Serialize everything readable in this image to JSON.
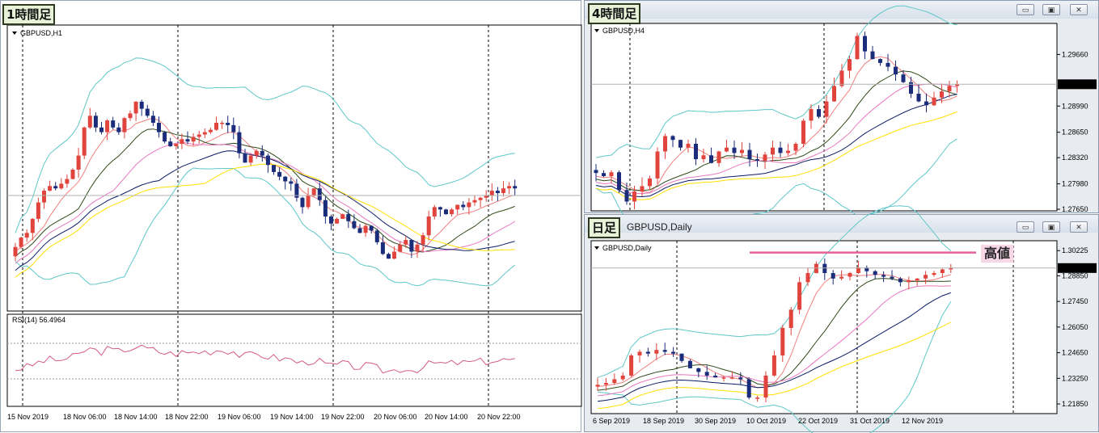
{
  "panels": {
    "h1": {
      "badge": "1時間足",
      "title": "GBPUSD,H1"
    },
    "h4": {
      "badge": "4時間足",
      "title": "GBPUSD,H4"
    },
    "daily": {
      "badge": "日足",
      "window_title": "GBPUSD,Daily",
      "title": "GBPUSD,Daily",
      "high_label": "高値"
    }
  },
  "window_buttons": {
    "minimize": "▭",
    "restore": "▣",
    "close": "✕"
  },
  "chart_data": [
    {
      "id": "h1",
      "type": "candlestick",
      "title": "GBPUSD,H1",
      "x_labels": [
        "15 Nov 2019",
        "18 Nov 06:00",
        "18 Nov 14:00",
        "18 Nov 22:00",
        "19 Nov 06:00",
        "19 Nov 14:00",
        "19 Nov 22:00",
        "20 Nov 06:00",
        "20 Nov 14:00",
        "20 Nov 22:00"
      ],
      "indicator": {
        "name": "RSI(14)",
        "value": "56.4964"
      },
      "indicators_drawn": [
        "Bollinger Bands",
        "moving averages (red, dark green, pink, navy, yellow)"
      ],
      "ylim": [
        0,
        1
      ],
      "closes": [
        0.17,
        0.21,
        0.23,
        0.29,
        0.36,
        0.41,
        0.43,
        0.42,
        0.44,
        0.46,
        0.5,
        0.56,
        0.68,
        0.73,
        0.68,
        0.66,
        0.71,
        0.68,
        0.66,
        0.72,
        0.74,
        0.79,
        0.76,
        0.73,
        0.7,
        0.66,
        0.62,
        0.6,
        0.61,
        0.63,
        0.62,
        0.64,
        0.65,
        0.66,
        0.67,
        0.7,
        0.7,
        0.69,
        0.66,
        0.57,
        0.53,
        0.56,
        0.58,
        0.56,
        0.52,
        0.49,
        0.47,
        0.45,
        0.44,
        0.38,
        0.34,
        0.39,
        0.42,
        0.37,
        0.3,
        0.27,
        0.29,
        0.31,
        0.28,
        0.25,
        0.23,
        0.26,
        0.24,
        0.19,
        0.14,
        0.12,
        0.15,
        0.18,
        0.2,
        0.15,
        0.18,
        0.22,
        0.3,
        0.34,
        0.33,
        0.31,
        0.33,
        0.35,
        0.34,
        0.36,
        0.37,
        0.38,
        0.39,
        0.41,
        0.4,
        0.42,
        0.43,
        0.42
      ]
    },
    {
      "id": "h4",
      "type": "candlestick",
      "title": "GBPUSD,H4",
      "y_ticks": [
        "1.29660",
        "1.28990",
        "1.28650",
        "1.28320",
        "1.27980",
        "1.27650"
      ],
      "current_price": "1.29273",
      "closes": [
        1.2812,
        1.2808,
        1.2813,
        1.279,
        1.2775,
        1.2788,
        1.2795,
        1.2805,
        1.284,
        1.286,
        1.2855,
        1.2845,
        1.285,
        1.283,
        1.2835,
        1.2825,
        1.284,
        1.2845,
        1.2838,
        1.2842,
        1.283,
        1.2828,
        1.2836,
        1.2845,
        1.2838,
        1.2841,
        1.285,
        1.288,
        1.2895,
        1.2885,
        1.2905,
        1.2925,
        1.2945,
        1.296,
        1.299,
        1.297,
        1.296,
        1.2955,
        1.295,
        1.294,
        1.293,
        1.2915,
        1.2905,
        1.29,
        1.291,
        1.2918,
        1.2925,
        1.2927
      ]
    },
    {
      "id": "daily",
      "type": "candlestick",
      "title": "GBPUSD,Daily",
      "x_labels": [
        "6 Sep 2019",
        "18 Sep 2019",
        "30 Sep 2019",
        "10 Oct 2019",
        "22 Oct 2019",
        "31 Oct 2019",
        "12 Nov 2019"
      ],
      "y_ticks": [
        "1.30225",
        "1.28850",
        "1.27450",
        "1.26050",
        "1.24650",
        "1.23250",
        "1.21850"
      ],
      "current_price": "1.29273",
      "annotation": "高値",
      "closes": [
        1.229,
        1.23,
        1.232,
        1.234,
        1.245,
        1.247,
        1.246,
        1.248,
        1.247,
        1.246,
        1.242,
        1.238,
        1.236,
        1.234,
        1.233,
        1.233,
        1.233,
        1.232,
        1.222,
        1.222,
        1.234,
        1.245,
        1.26,
        1.27,
        1.285,
        1.29,
        1.295,
        1.29,
        1.287,
        1.288,
        1.29,
        1.293,
        1.291,
        1.289,
        1.288,
        1.287,
        1.285,
        1.286,
        1.287,
        1.289,
        1.29,
        1.292,
        1.2927
      ]
    }
  ]
}
